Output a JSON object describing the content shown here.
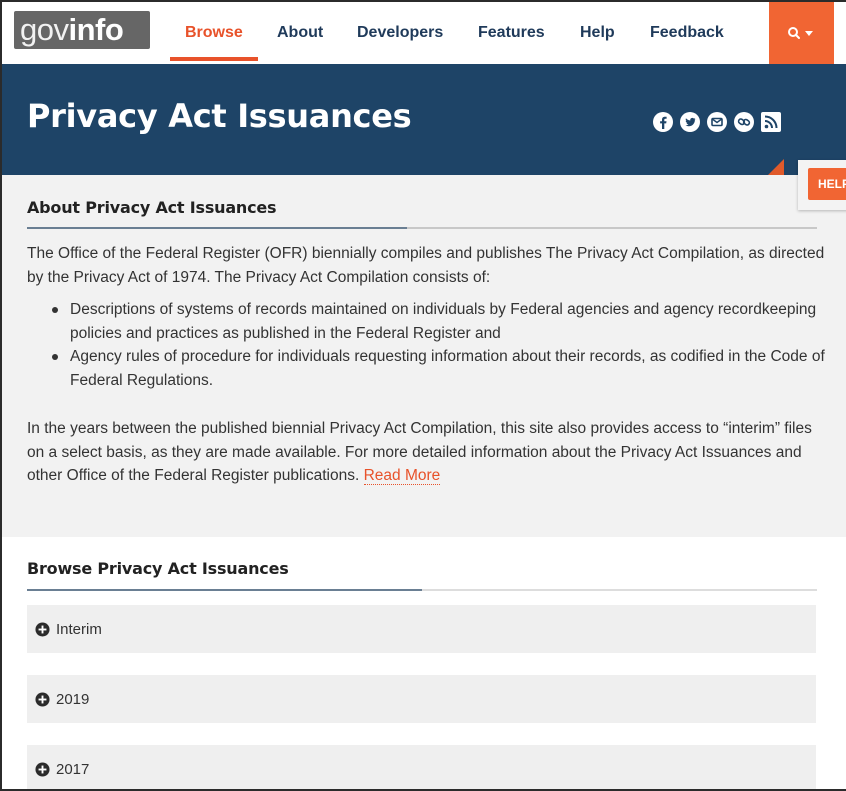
{
  "logo": {
    "light": "gov",
    "bold": "info"
  },
  "nav": {
    "items": [
      {
        "label": "Browse",
        "active": true
      },
      {
        "label": "About",
        "active": false
      },
      {
        "label": "Developers",
        "active": false
      },
      {
        "label": "Features",
        "active": false
      },
      {
        "label": "Help",
        "active": false
      },
      {
        "label": "Feedback",
        "active": false
      }
    ]
  },
  "header": {
    "title": "Privacy Act Issuances",
    "social_icons": [
      "facebook-icon",
      "twitter-icon",
      "email-icon",
      "link-icon",
      "rss-icon"
    ]
  },
  "help_tab": {
    "label": "HELP"
  },
  "about": {
    "heading": "About Privacy Act Issuances",
    "intro": "The Office of the Federal Register (OFR) biennially compiles and publishes The Privacy Act Compilation, as directed by the Privacy Act of 1974. The Privacy Act Compilation consists of:",
    "bullets": [
      "Descriptions of systems of records maintained on individuals by Federal agencies and agency recordkeeping policies and practices as published in the Federal Register and",
      "Agency rules of procedure for individuals requesting information about their records, as codified in the Code of Federal Regulations."
    ],
    "outro": "In the years between the published biennial Privacy Act Compilation, this site also provides access to “interim” files on a select basis, as they are made available. For more detailed information about the Privacy Act Issuances and other Office of the Federal Register publications.",
    "read_more": "Read More"
  },
  "browse": {
    "heading": "Browse Privacy Act Issuances",
    "items": [
      {
        "label": "Interim"
      },
      {
        "label": "2019"
      },
      {
        "label": "2017"
      }
    ]
  },
  "colors": {
    "accent": "#f16533",
    "header_bg": "#1e4467",
    "nav_text": "#1f3a5a",
    "panel_bg": "#f2f2f2"
  }
}
